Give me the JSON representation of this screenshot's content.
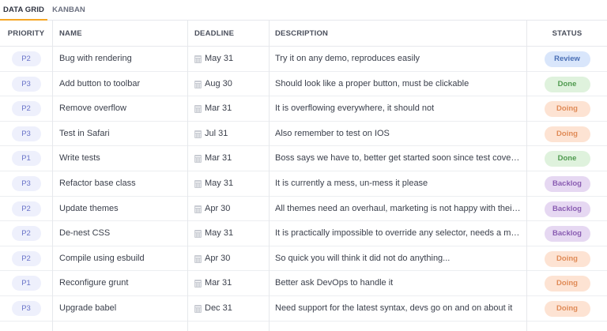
{
  "tabs": [
    {
      "label": "DATA GRID",
      "active": true
    },
    {
      "label": "KANBAN",
      "active": false
    }
  ],
  "columns": {
    "priority": "PRIORITY",
    "name": "NAME",
    "deadline": "DEADLINE",
    "description": "DESCRIPTION",
    "status": "STATUS"
  },
  "rows": [
    {
      "priority": "P2",
      "name": "Bug with rendering",
      "deadline": "May 31",
      "description": "Try it on any demo, reproduces easily",
      "status": "Review"
    },
    {
      "priority": "P3",
      "name": "Add button to toolbar",
      "deadline": "Aug 30",
      "description": "Should look like a proper button, must be clickable",
      "status": "Done"
    },
    {
      "priority": "P2",
      "name": "Remove overflow",
      "deadline": "Mar 31",
      "description": "It is overflowing everywhere, it should not",
      "status": "Doing"
    },
    {
      "priority": "P3",
      "name": "Test in Safari",
      "deadline": "Jul 31",
      "description": "Also remember to test on IOS",
      "status": "Doing"
    },
    {
      "priority": "P1",
      "name": "Write tests",
      "deadline": "Mar 31",
      "description": "Boss says we have to, better get started soon since test covera...",
      "status": "Done"
    },
    {
      "priority": "P3",
      "name": "Refactor base class",
      "deadline": "May 31",
      "description": "It is currently a mess, un-mess it please",
      "status": "Backlog"
    },
    {
      "priority": "P2",
      "name": "Update themes",
      "deadline": "Apr 30",
      "description": "All themes need an overhaul, marketing is not happy with their ...",
      "status": "Backlog"
    },
    {
      "priority": "P2",
      "name": "De-nest CSS",
      "deadline": "May 31",
      "description": "It is practically impossible to override any selector, needs a maj...",
      "status": "Backlog"
    },
    {
      "priority": "P2",
      "name": "Compile using esbuild",
      "deadline": "Apr 30",
      "description": "So quick you will think it did not do anything...",
      "status": "Doing"
    },
    {
      "priority": "P1",
      "name": "Reconfigure grunt",
      "deadline": "Mar 31",
      "description": "Better ask DevOps to handle it",
      "status": "Doing"
    },
    {
      "priority": "P3",
      "name": "Upgrade babel",
      "deadline": "Dec 31",
      "description": "Need support for the latest syntax, devs go on and on about it",
      "status": "Doing"
    }
  ],
  "status_styles": {
    "Review": "st-review",
    "Done": "st-done",
    "Doing": "st-doing",
    "Backlog": "st-backlog"
  },
  "colors": {
    "accent": "#f5a623",
    "review": "#d9e6fb",
    "done": "#dff2dd",
    "doing": "#fde3d3",
    "backlog": "#e6d8f2"
  }
}
